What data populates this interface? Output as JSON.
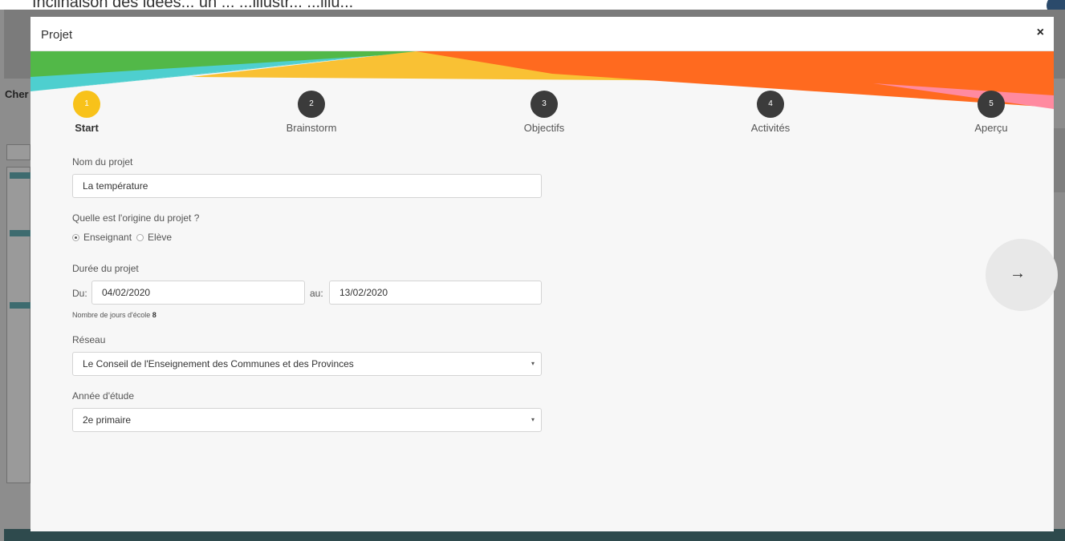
{
  "background": {
    "top_text": "Inclinaison des idées... un ... ...illustr... ...illu...",
    "side_label": "Cher"
  },
  "modal": {
    "title": "Projet",
    "close_glyph": "×"
  },
  "stepper": {
    "steps": [
      {
        "number": "1",
        "label": "Start",
        "active": true
      },
      {
        "number": "2",
        "label": "Brainstorm",
        "active": false
      },
      {
        "number": "3",
        "label": "Objectifs",
        "active": false
      },
      {
        "number": "4",
        "label": "Activités",
        "active": false
      },
      {
        "number": "5",
        "label": "Aperçu",
        "active": false
      }
    ]
  },
  "form": {
    "project_name": {
      "label": "Nom du projet",
      "value": "La température"
    },
    "origin": {
      "label": "Quelle est l'origine du projet ?",
      "options": [
        {
          "label": "Enseignant",
          "checked": true
        },
        {
          "label": "Elève",
          "checked": false
        }
      ]
    },
    "duration": {
      "label": "Durée du projet",
      "from_label": "Du:",
      "from_value": "04/02/2020",
      "to_label": "au:",
      "to_value": "13/02/2020",
      "school_days_label": "Nombre de jours d'école",
      "school_days_value": "8"
    },
    "network": {
      "label": "Réseau",
      "value": "Le Conseil de l'Enseignement des Communes et des Provinces"
    },
    "year": {
      "label": "Année d'étude",
      "value": "2e primaire"
    }
  },
  "nav": {
    "next_glyph": "→",
    "caret_glyph": "▾"
  },
  "colors": {
    "active_step": "#f8c21a",
    "inactive_step": "#3b3b3b",
    "banner_teal": "#4ecfcf",
    "banner_green": "#4caf50",
    "banner_yellow": "#f9c134",
    "banner_orange": "#ff6a1f",
    "banner_pink": "#ff8aa0"
  }
}
